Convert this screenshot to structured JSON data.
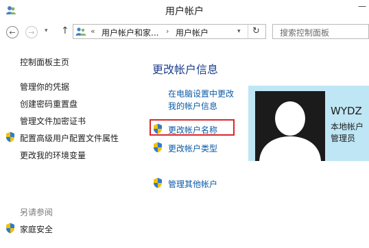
{
  "window": {
    "title": "用户帐户",
    "control_label": "—"
  },
  "nav": {
    "back_glyph": "←",
    "forward_glyph": "→",
    "dropdown_glyph": "▾",
    "up_glyph": "↑"
  },
  "address": {
    "overflow_glyph": "«",
    "crumbs": [
      "用户帐户和家...",
      "用户帐户"
    ],
    "separator": "›",
    "dropdown_glyph": "▾",
    "refresh_glyph": "↻"
  },
  "search": {
    "placeholder": "搜索控制面板"
  },
  "sidebar": {
    "home": "控制面板主页",
    "links": [
      "管理你的凭据",
      "创建密码重置盘",
      "管理文件加密证书",
      "配置高级用户配置文件属性",
      "更改我的环境变量"
    ],
    "see_also_title": "另请参阅",
    "see_also_links": [
      "家庭安全"
    ]
  },
  "main": {
    "title": "更改帐户信息",
    "pc_settings_link_line1": "在电脑设置中更改",
    "pc_settings_link_line2": "我的帐户信息",
    "actions": [
      "更改帐户名称",
      "更改帐户类型"
    ],
    "manage_other": "管理其他帐户"
  },
  "user": {
    "name": "WYDZ",
    "account_type": "本地帐户",
    "role": "管理员"
  },
  "colors": {
    "link": "#0b5aa6",
    "heading": "#1e3f8c",
    "user_card_bg": "#bfe6f5",
    "highlight": "#d9262b"
  }
}
